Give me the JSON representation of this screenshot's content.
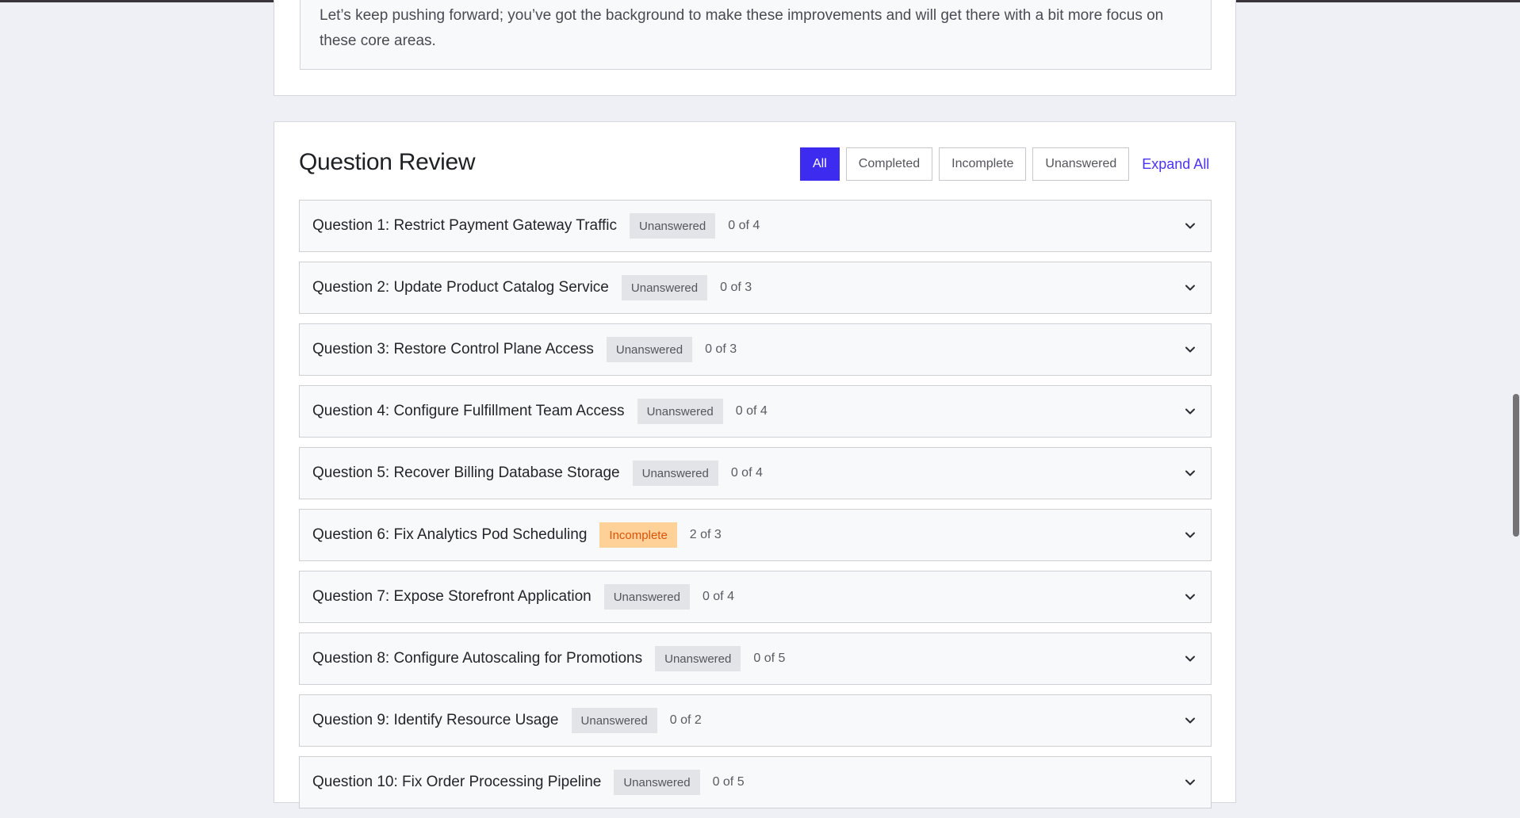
{
  "feedback": {
    "text": "Let’s keep pushing forward; you’ve got the background to make these improvements and will get there with a bit more focus on these core areas."
  },
  "review": {
    "title": "Question Review",
    "filters": [
      "All",
      "Completed",
      "Incomplete",
      "Unanswered"
    ],
    "active_filter": "All",
    "expand_all": "Expand All"
  },
  "questions": [
    {
      "title": "Question 1: Restrict Payment Gateway Traffic",
      "status": "Unanswered",
      "progress": "0 of 4"
    },
    {
      "title": "Question 2: Update Product Catalog Service",
      "status": "Unanswered",
      "progress": "0 of 3"
    },
    {
      "title": "Question 3: Restore Control Plane Access",
      "status": "Unanswered",
      "progress": "0 of 3"
    },
    {
      "title": "Question 4: Configure Fulfillment Team Access",
      "status": "Unanswered",
      "progress": "0 of 4"
    },
    {
      "title": "Question 5: Recover Billing Database Storage",
      "status": "Unanswered",
      "progress": "0 of 4"
    },
    {
      "title": "Question 6: Fix Analytics Pod Scheduling",
      "status": "Incomplete",
      "progress": "2 of 3"
    },
    {
      "title": "Question 7: Expose Storefront Application",
      "status": "Unanswered",
      "progress": "0 of 4"
    },
    {
      "title": "Question 8: Configure Autoscaling for Promotions",
      "status": "Unanswered",
      "progress": "0 of 5"
    },
    {
      "title": "Question 9: Identify Resource Usage",
      "status": "Unanswered",
      "progress": "0 of 2"
    },
    {
      "title": "Question 10: Fix Order Processing Pipeline",
      "status": "Unanswered",
      "progress": "0 of 5"
    }
  ],
  "colors": {
    "accent": "#3d2bf0",
    "incomplete_bg": "#fdd198",
    "incomplete_text": "#d9540b",
    "unanswered_bg": "#e3e4e8"
  },
  "icons": {
    "row_toggle": "chevron-down-icon"
  }
}
